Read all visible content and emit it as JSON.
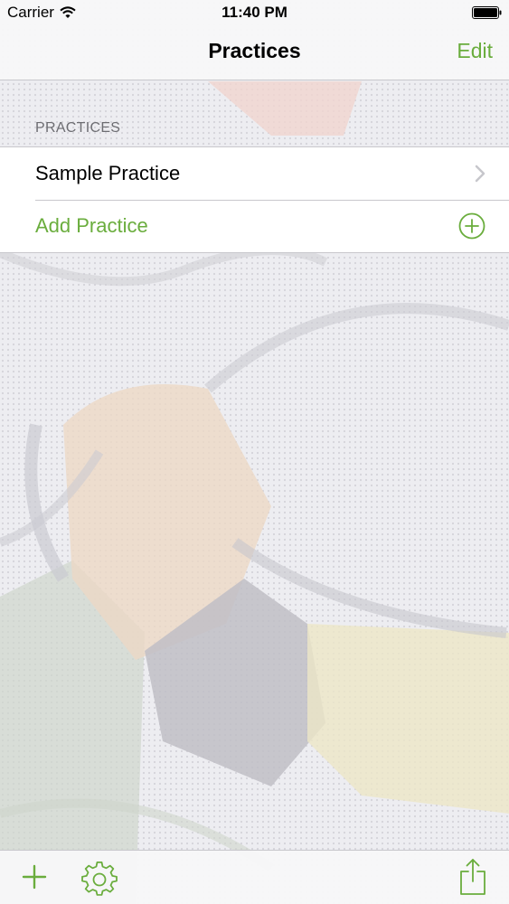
{
  "status_bar": {
    "carrier": "Carrier",
    "time": "11:40 PM"
  },
  "nav": {
    "title": "Practices",
    "edit_label": "Edit"
  },
  "section": {
    "header": "PRACTICES",
    "rows": [
      {
        "label": "Sample Practice",
        "accessory": "chevron-right-icon"
      },
      {
        "label": "Add Practice",
        "accessory": "add-circle-icon"
      }
    ]
  },
  "toolbar": {
    "items": [
      "plus-icon",
      "gear-icon",
      "share-icon"
    ]
  },
  "colors": {
    "accent": "#6aad3d",
    "nav_background": "#f7f7f8",
    "section_header": "#6d6d72",
    "separator": "#c8c7cc"
  }
}
